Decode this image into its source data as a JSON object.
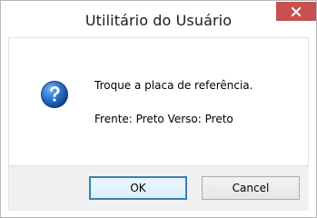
{
  "window": {
    "title": "Utilitário do Usuário",
    "close_icon": "close-x-icon",
    "close_color": "#c75050"
  },
  "message": {
    "icon": "question-icon",
    "icon_color": "#1f5fb0",
    "line1": "Troque a placa de referência.",
    "line2": "Frente:  Preto  Verso: Preto"
  },
  "buttons": {
    "ok_label": "OK",
    "cancel_label": "Cancel",
    "default_border_color": "#3c7fb1"
  }
}
